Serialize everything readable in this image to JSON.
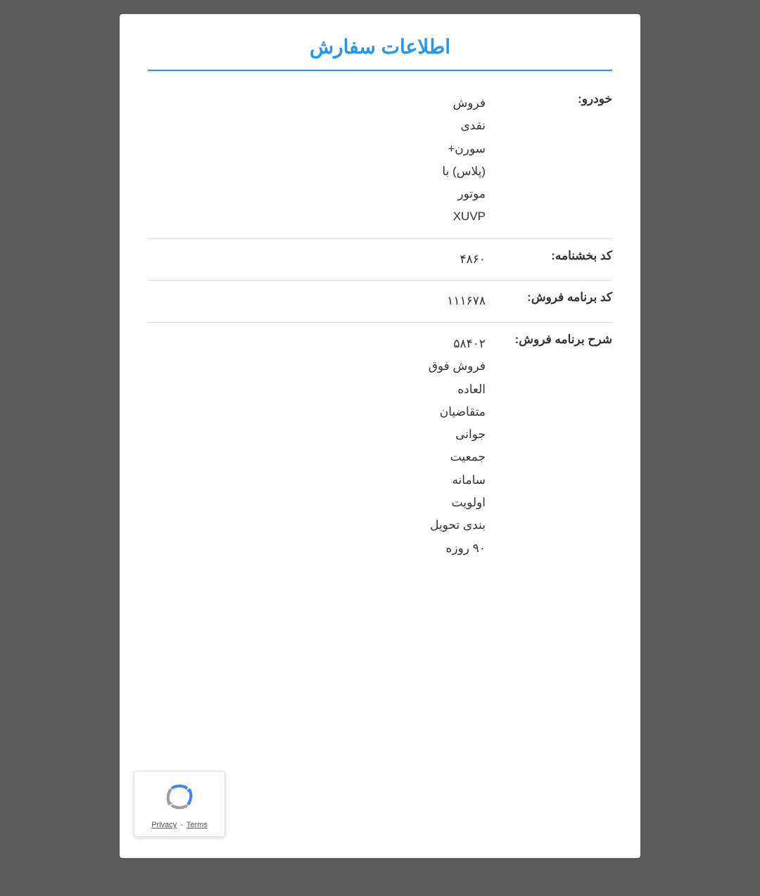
{
  "page": {
    "background_color": "#5a5a5a",
    "card_background": "#ffffff"
  },
  "header": {
    "title": "اطلاعات سفارش",
    "title_color": "#2196F3"
  },
  "rows": [
    {
      "label": "خودرو:",
      "value": "فروش\nنقدی\nسورن+\n(پلاس) با\nموتور\nXUVP"
    },
    {
      "label": "کد بخشنامه:",
      "value": "۴۸۶۰"
    },
    {
      "label": "کد برنامه فروش:",
      "value": "۱۱۱۶۷۸"
    },
    {
      "label": "شرح برنامه فروش:",
      "value": "۵۸۴۰۲\nفروش فوق\nالعاده\nمتقاضیان\nجوانی\nجمعیت\nسامانه\nاولویت\nبندی تحویل\n۹۰ روزه"
    }
  ],
  "recaptcha": {
    "privacy_label": "Privacy",
    "separator": "-",
    "terms_label": "Terms"
  }
}
